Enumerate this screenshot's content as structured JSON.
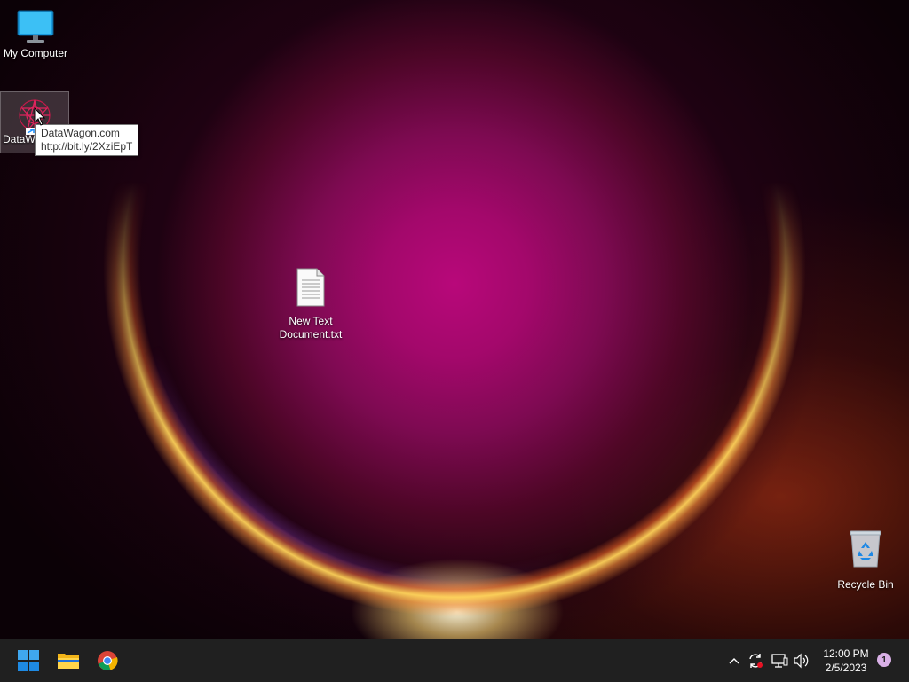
{
  "desktop": {
    "icons": [
      {
        "label": "My Computer"
      },
      {
        "label": "DataW"
      },
      {
        "label": "New Text Document.txt",
        "label_lines": [
          "New Text",
          "Document.txt"
        ]
      },
      {
        "label": "Recycle Bin"
      }
    ],
    "tooltip": {
      "line1": "DataWagon.com",
      "line2": "http://bit.ly/2XziEpT"
    }
  },
  "taskbar": {
    "pinned": [
      "start-icon",
      "file-explorer-icon",
      "chrome-icon"
    ],
    "tray_icons": [
      "chevron-up-icon",
      "sync-icon",
      "network-icon",
      "volume-icon"
    ],
    "clock": {
      "time": "12:00 PM",
      "date": "2/5/2023"
    },
    "notification_count": "1"
  },
  "colors": {
    "taskbar": "#202020",
    "accent": "#1e90ff",
    "notification_badge": "#d9b0e6"
  }
}
